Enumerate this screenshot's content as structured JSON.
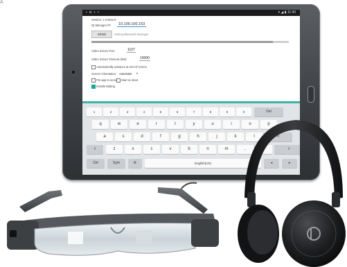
{
  "corner_glyph": "A",
  "tablet": {
    "status_icons_left": "▪ ◘ ▪ ▪",
    "status_right": "▾ ◢ ▮ 11:40",
    "settings": {
      "version_label": "Version: 1.0 Beta 9",
      "ip_label": "IQ Manager IP:",
      "ip_value": "10.100.100.153",
      "send_label": "SEND",
      "status_text": "Setting Bluetooth Manager",
      "progress_fraction": 0.92,
      "port_label": "Video Server Port:",
      "port_value": "1107",
      "timeout_label": "Video Server Timeout (MS):",
      "timeout_value": "10000",
      "auto_advance_label": "Automatically advance at end of screen",
      "orientation_label": "Screen Orientation:",
      "orientation_value": "Automatic",
      "pin_label": "Pin app to screen",
      "start_boot_label": "Start on boot",
      "editing_label": "Enable Editing"
    },
    "keyboard": {
      "row1": [
        "1",
        "2",
        "3",
        "4",
        "5",
        "6",
        "7",
        "8",
        "9",
        "0",
        "Del"
      ],
      "row1_alt": [
        "!",
        "@",
        "#",
        "$",
        "%",
        "^",
        "&",
        "*",
        "(",
        ")"
      ],
      "row2": [
        "q",
        "w",
        "e",
        "r",
        "t",
        "y",
        "u",
        "i",
        "o",
        "p"
      ],
      "row3": [
        "a",
        "s",
        "d",
        "f",
        "g",
        "h",
        "j",
        "k",
        "l",
        "↵"
      ],
      "row4": [
        "⇧",
        "z",
        "x",
        "c",
        "v",
        "b",
        "n",
        "m",
        ",",
        ".",
        "⇧"
      ],
      "row5": [
        "Ctrl",
        "Sym",
        "⚙",
        "English(US)",
        "◂",
        "▸"
      ]
    }
  },
  "colors": {
    "accent": "#38b3a8",
    "tablet_body": "#3e4246",
    "headphone_body": "#1b1c1e"
  }
}
